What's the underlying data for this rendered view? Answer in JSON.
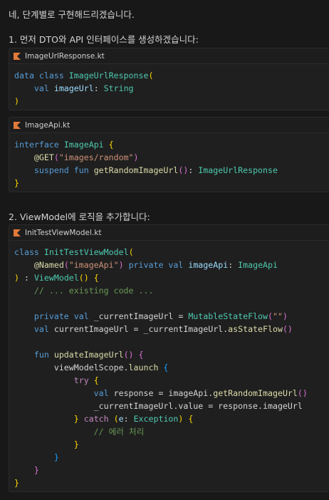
{
  "intro": "네, 단계별로 구현해드리겠습니다.",
  "step1": "1. 먼저 DTO와 API 인터페이스를 생성하겠습니다:",
  "step2": "2. ViewModel에 로직을 추가합니다:",
  "files": {
    "dto": "ImageUrlResponse.kt",
    "api": "ImageApi.kt",
    "vm": "InitTestViewModel.kt"
  },
  "code": {
    "dto": [
      [
        [
          "data class ",
          "kwb"
        ],
        [
          "ImageUrlResponse",
          "type"
        ],
        [
          "(",
          "br1"
        ]
      ],
      [
        [
          "    val ",
          "kwb"
        ],
        [
          "imageUrl",
          "var"
        ],
        [
          ": ",
          "plain"
        ],
        [
          "String",
          "type"
        ]
      ],
      [
        [
          ")",
          "br1"
        ]
      ]
    ],
    "api": [
      [
        [
          "interface ",
          "kwb"
        ],
        [
          "ImageApi ",
          "type"
        ],
        [
          "{",
          "br1"
        ]
      ],
      [
        [
          "    @GET",
          "ann"
        ],
        [
          "(",
          "br2"
        ],
        [
          "\"images/random\"",
          "str"
        ],
        [
          ")",
          "br2"
        ]
      ],
      [
        [
          "    suspend fun ",
          "kwb"
        ],
        [
          "getRandomImageUrl",
          "fn"
        ],
        [
          "()",
          "br2"
        ],
        [
          ": ",
          "plain"
        ],
        [
          "ImageUrlResponse",
          "type"
        ]
      ],
      [
        [
          "}",
          "br1"
        ]
      ]
    ],
    "vm": [
      [
        [
          "class ",
          "kwb"
        ],
        [
          "InitTestViewModel",
          "type"
        ],
        [
          "(",
          "br1"
        ]
      ],
      [
        [
          "    @Named",
          "ann"
        ],
        [
          "(",
          "br2"
        ],
        [
          "\"imageApi\"",
          "str"
        ],
        [
          ")",
          "br2"
        ],
        [
          " private val ",
          "kwb"
        ],
        [
          "imageApi",
          "var"
        ],
        [
          ": ",
          "plain"
        ],
        [
          "ImageApi",
          "type"
        ]
      ],
      [
        [
          ")",
          "br1"
        ],
        [
          " : ",
          "plain"
        ],
        [
          "ViewModel",
          "type"
        ],
        [
          "()",
          "br1"
        ],
        [
          " ",
          "plain"
        ],
        [
          "{",
          "br1"
        ]
      ],
      [
        [
          "    // ... existing code ...",
          "cmt"
        ]
      ],
      [
        [
          "",
          "plain"
        ]
      ],
      [
        [
          "    private val ",
          "kwb"
        ],
        [
          "_currentImageUrl",
          "prop"
        ],
        [
          " = ",
          "plain"
        ],
        [
          "MutableStateFlow",
          "type"
        ],
        [
          "(",
          "br2"
        ],
        [
          "\"\"",
          "str"
        ],
        [
          ")",
          "br2"
        ]
      ],
      [
        [
          "    val ",
          "kwb"
        ],
        [
          "currentImageUrl",
          "prop"
        ],
        [
          " = _currentImageUrl.",
          "plain"
        ],
        [
          "asStateFlow",
          "fn"
        ],
        [
          "()",
          "br2"
        ]
      ],
      [
        [
          "",
          "plain"
        ]
      ],
      [
        [
          "    fun ",
          "kwb"
        ],
        [
          "updateImageUrl",
          "fn"
        ],
        [
          "()",
          "br2"
        ],
        [
          " ",
          "plain"
        ],
        [
          "{",
          "br2"
        ]
      ],
      [
        [
          "        viewModelScope.",
          "plain"
        ],
        [
          "launch",
          "fn"
        ],
        [
          " ",
          "plain"
        ],
        [
          "{",
          "br3"
        ]
      ],
      [
        [
          "            try ",
          "kw"
        ],
        [
          "{",
          "br1"
        ]
      ],
      [
        [
          "                val ",
          "kwb"
        ],
        [
          "response",
          "prop"
        ],
        [
          " = imageApi.",
          "plain"
        ],
        [
          "getRandomImageUrl",
          "fn"
        ],
        [
          "()",
          "br2"
        ]
      ],
      [
        [
          "                _currentImageUrl.value = response.imageUrl",
          "plain"
        ]
      ],
      [
        [
          "            ",
          "plain"
        ],
        [
          "}",
          "br1"
        ],
        [
          " catch ",
          "kw"
        ],
        [
          "(",
          "br1"
        ],
        [
          "e",
          "var"
        ],
        [
          ": ",
          "plain"
        ],
        [
          "Exception",
          "type"
        ],
        [
          ")",
          "br1"
        ],
        [
          " ",
          "plain"
        ],
        [
          "{",
          "br1"
        ]
      ],
      [
        [
          "                // 에러 처리",
          "cmt"
        ]
      ],
      [
        [
          "            ",
          "plain"
        ],
        [
          "}",
          "br1"
        ]
      ],
      [
        [
          "        ",
          "plain"
        ],
        [
          "}",
          "br3"
        ]
      ],
      [
        [
          "    ",
          "plain"
        ],
        [
          "}",
          "br2"
        ]
      ],
      [
        [
          "}",
          "br1"
        ]
      ]
    ]
  },
  "colors": {
    "background": "#181818",
    "card": "#1f1f1f",
    "kotlin_icon": "#e07a3a"
  },
  "icons": {
    "file_icon": "kotlin-file-icon"
  }
}
